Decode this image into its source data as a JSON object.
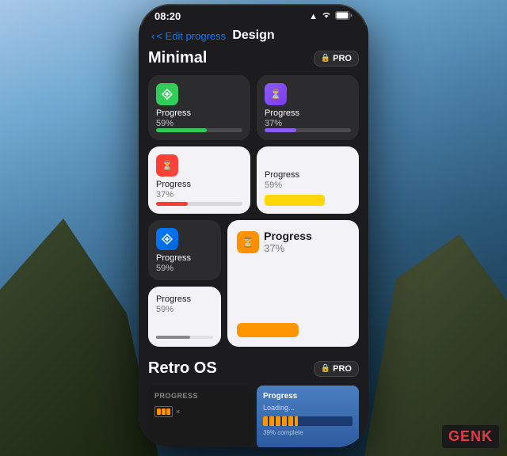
{
  "background": {
    "gradient": "coastal"
  },
  "phone": {
    "status_bar": {
      "time": "08:20",
      "signal": "▲",
      "wifi": "WiFi",
      "battery": "🔋"
    },
    "nav": {
      "back_label": "< Edit progress",
      "title": "Design"
    },
    "sections": [
      {
        "id": "minimal",
        "title": "Minimal",
        "pro_badge": "🔒 PRO",
        "widgets": [
          {
            "id": "w1",
            "style": "dark",
            "icon_color": "green",
            "icon_symbol": "✕",
            "label": "Progress",
            "value": "59%",
            "progress": 59,
            "bar_color": "green"
          },
          {
            "id": "w2",
            "style": "dark",
            "icon_color": "purple",
            "icon_symbol": "⏳",
            "label": "Progress",
            "value": "37%",
            "progress": 37,
            "bar_color": "purple"
          },
          {
            "id": "w3",
            "style": "light",
            "icon_color": "red",
            "icon_symbol": "⏳",
            "label": "Progress",
            "value": "37%",
            "progress": 37,
            "bar_color": "red"
          },
          {
            "id": "w4",
            "style": "light",
            "icon_color": "yellow",
            "label": "Progress",
            "value": "59%",
            "progress": 59,
            "bar_color": "yellow"
          },
          {
            "id": "w5",
            "style": "dark",
            "icon_color": "blue",
            "icon_symbol": "✕",
            "label": "Progress",
            "value": "59%",
            "progress": 59
          },
          {
            "id": "w6",
            "style": "light_big",
            "icon_color": "orange",
            "icon_symbol": "⏳",
            "label": "Progress",
            "value": "37%",
            "progress": 37,
            "bar_color": "orange"
          },
          {
            "id": "w7",
            "style": "light",
            "label": "Progress",
            "value": "59%"
          }
        ]
      },
      {
        "id": "retro_os",
        "title": "Retro OS",
        "pro_badge": "🔒 PRO",
        "widgets": [
          {
            "id": "rw1",
            "style": "dark",
            "title": "PROGRESS",
            "battery_cells": 3
          },
          {
            "id": "rw2",
            "style": "blue",
            "title": "Progress",
            "loading": "Loading...",
            "progress": 39,
            "complete_text": "39% complete"
          }
        ]
      }
    ]
  },
  "genk_logo": "GENK"
}
